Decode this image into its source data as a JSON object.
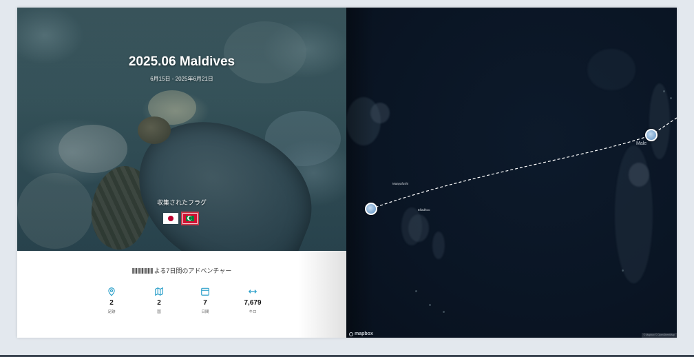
{
  "album": {
    "title": "2025.06 Maldives",
    "dates": "6月15日 - 2025年6月21日",
    "flags_label": "収集されたフラグ",
    "flags": [
      {
        "country": "Japan",
        "icon": "japan-flag-icon"
      },
      {
        "country": "Maldives",
        "icon": "maldives-flag-icon"
      }
    ]
  },
  "summary": {
    "adventure_text": "よる7日間のアドベンチャー",
    "stats": [
      {
        "value": "2",
        "label": "足跡",
        "icon": "map-pin-icon"
      },
      {
        "value": "2",
        "label": "国",
        "icon": "map-icon"
      },
      {
        "value": "7",
        "label": "日間",
        "icon": "calendar-icon"
      },
      {
        "value": "7,679",
        "label": "キロ",
        "icon": "distance-arrows-icon"
      }
    ]
  },
  "map": {
    "labels": [
      "Maayafushi",
      "Elladhoo",
      "Male"
    ],
    "logo": "mapbox",
    "attribution": "© Mapbox © OpenStreetMap"
  },
  "colors": {
    "accent": "#2a9fc9",
    "map_background": "#0a1524",
    "route": "#ffffff"
  }
}
